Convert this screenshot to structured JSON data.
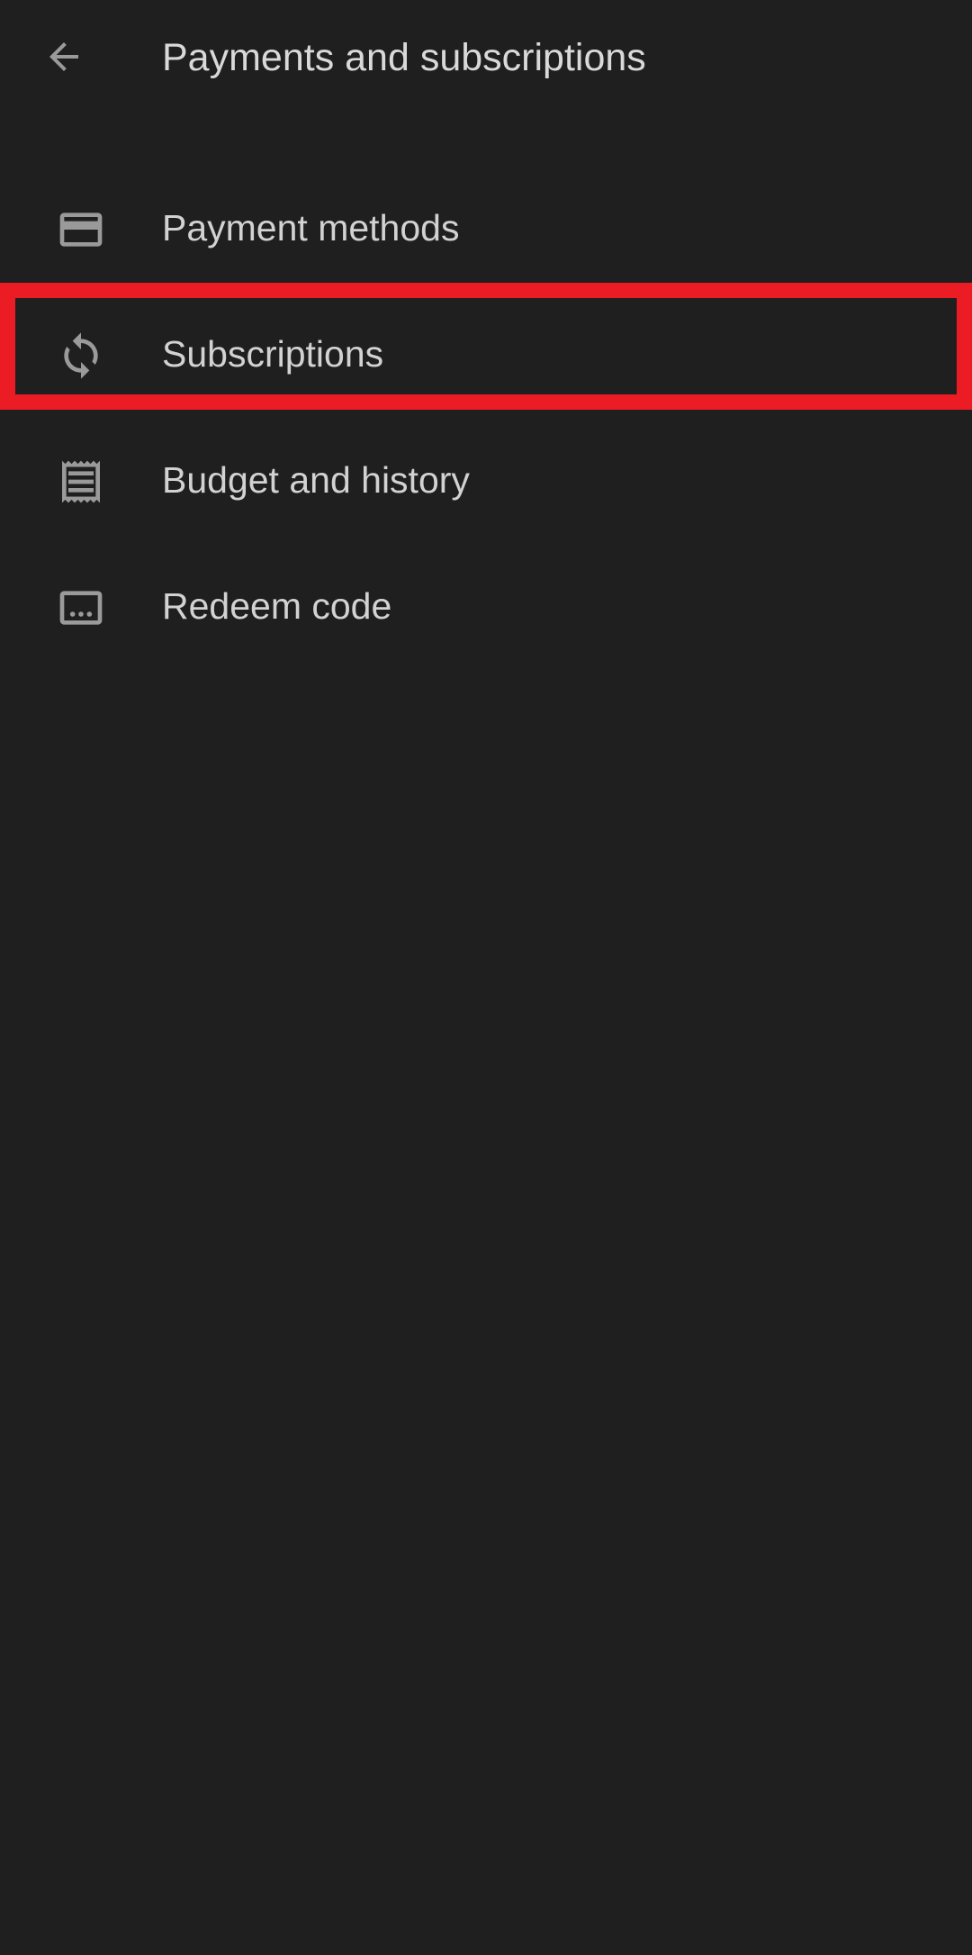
{
  "app_bar": {
    "title": "Payments and subscriptions",
    "back_icon": "arrow-back-icon"
  },
  "menu": {
    "items": [
      {
        "label": "Payment methods",
        "icon": "credit-card-icon"
      },
      {
        "label": "Subscriptions",
        "icon": "sync-icon"
      },
      {
        "label": "Budget and history",
        "icon": "receipt-icon"
      },
      {
        "label": "Redeem code",
        "icon": "redeem-code-icon"
      }
    ]
  },
  "colors": {
    "background": "#1f1f1f",
    "icon": "#9a9a9a",
    "text": "#d2d2d2",
    "highlight": "#ec1c24"
  }
}
